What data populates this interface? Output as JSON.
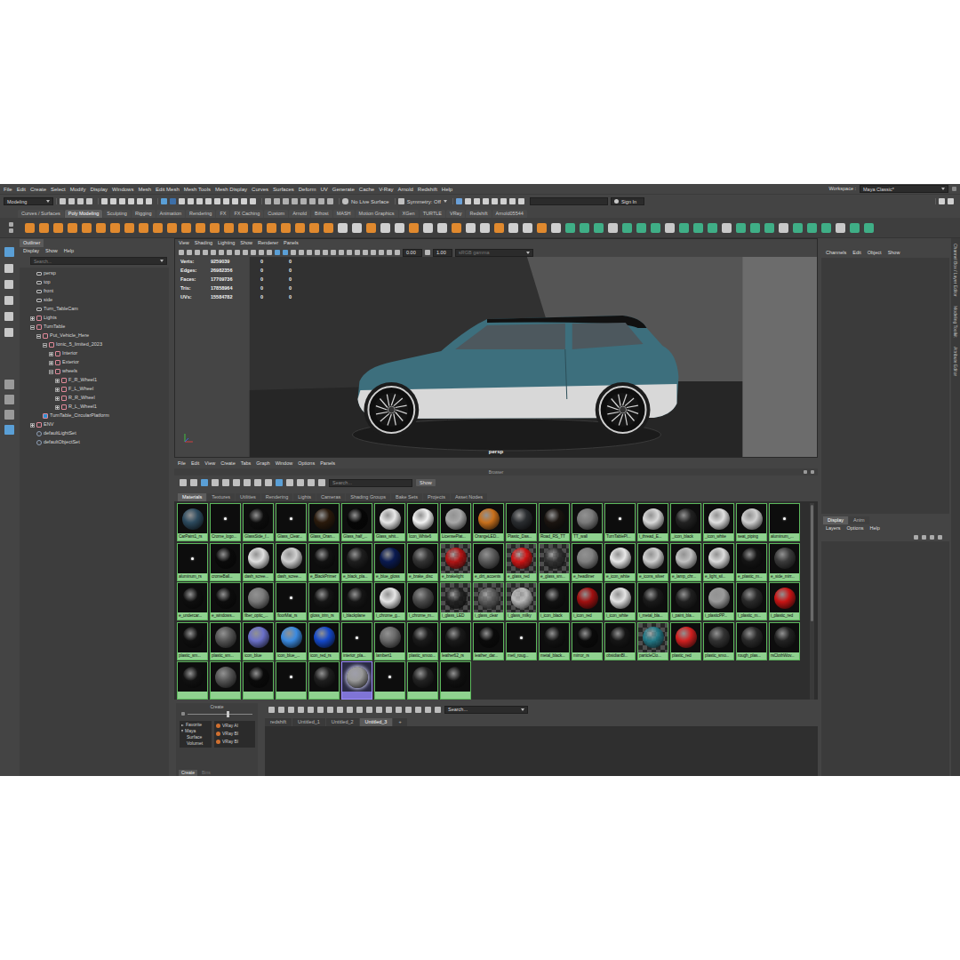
{
  "window": {
    "workspace_label": "Workspace :",
    "workspace": "Maya Classic*"
  },
  "menu_bar": [
    "File",
    "Edit",
    "Create",
    "Select",
    "Modify",
    "Display",
    "Windows",
    "Mesh",
    "Edit Mesh",
    "Mesh Tools",
    "Mesh Display",
    "Curves",
    "Surfaces",
    "Deform",
    "UV",
    "Generate",
    "Cache",
    "V-Ray",
    "Arnold",
    "Redshift",
    "Help"
  ],
  "status_line": {
    "mode": "Modeling",
    "live_surface": "No Live Surface",
    "symmetry": "Symmetry: Off",
    "sign_in": "Sign In"
  },
  "shelf_tabs": [
    {
      "label": "Curves / Surfaces",
      "selected": false
    },
    {
      "label": "Poly Modeling",
      "selected": true
    },
    {
      "label": "Sculpting",
      "selected": false
    },
    {
      "label": "Rigging",
      "selected": false
    },
    {
      "label": "Animation",
      "selected": false
    },
    {
      "label": "Rendering",
      "selected": false
    },
    {
      "label": "FX",
      "selected": false
    },
    {
      "label": "FX Caching",
      "selected": false
    },
    {
      "label": "Custom",
      "selected": false
    },
    {
      "label": "Arnold",
      "selected": false
    },
    {
      "label": "Bifrost",
      "selected": false
    },
    {
      "label": "MASH",
      "selected": false
    },
    {
      "label": "Motion Graphics",
      "selected": false
    },
    {
      "label": "XGen",
      "selected": false
    },
    {
      "label": "TURTLE",
      "selected": false
    },
    {
      "label": "VRay",
      "selected": false
    },
    {
      "label": "Redshift",
      "selected": false
    },
    {
      "label": "Arnold05544",
      "selected": false
    }
  ],
  "outliner": {
    "title": "Outliner",
    "menu": [
      "Display",
      "Show",
      "Help"
    ],
    "search": {
      "placeholder": "Search..."
    },
    "items": [
      {
        "label": "persp",
        "kind": "camera"
      },
      {
        "label": "top",
        "kind": "camera"
      },
      {
        "label": "front",
        "kind": "camera"
      },
      {
        "label": "side",
        "kind": "camera"
      },
      {
        "label": "Turn_TableCam",
        "kind": "camera"
      },
      {
        "label": "Lights",
        "kind": "group",
        "expanded": false
      },
      {
        "label": "TurnTable",
        "kind": "group",
        "expanded": true,
        "children": [
          {
            "label": "Put_Vehicle_Here",
            "kind": "group",
            "expanded": true,
            "children": [
              {
                "label": "Ionic_5_limited_2023",
                "kind": "group",
                "expanded": true,
                "children": [
                  {
                    "label": "Interior",
                    "kind": "group",
                    "expanded": false
                  },
                  {
                    "label": "Exterior",
                    "kind": "group",
                    "expanded": false
                  },
                  {
                    "label": "wheels",
                    "kind": "group",
                    "expanded": true,
                    "children": [
                      {
                        "label": "F_R_Wheel1",
                        "kind": "group",
                        "expanded": false
                      },
                      {
                        "label": "F_L_Wheel",
                        "kind": "group",
                        "expanded": false
                      },
                      {
                        "label": "R_R_Wheel",
                        "kind": "group",
                        "expanded": false
                      },
                      {
                        "label": "R_L_Wheel1",
                        "kind": "group",
                        "expanded": false
                      }
                    ]
                  }
                ]
              }
            ]
          },
          {
            "label": "TurnTable_CircularPlatform",
            "kind": "mesh"
          }
        ]
      },
      {
        "label": "ENV",
        "kind": "group",
        "expanded": false
      },
      {
        "label": "defaultLightSet",
        "kind": "set"
      },
      {
        "label": "defaultObjectSet",
        "kind": "set"
      }
    ]
  },
  "viewport": {
    "menu": [
      "View",
      "Shading",
      "Lighting",
      "Show",
      "Renderer",
      "Panels"
    ],
    "exposure": "0.00",
    "gamma": "1.00",
    "color_space": "sRGB gamma",
    "camera": "persp",
    "hud": [
      {
        "label": "Verts:",
        "values": [
          "9259039",
          "0",
          "0"
        ]
      },
      {
        "label": "Edges:",
        "values": [
          "26982356",
          "0",
          "0"
        ]
      },
      {
        "label": "Faces:",
        "values": [
          "17709736",
          "0",
          "0"
        ]
      },
      {
        "label": "Tris:",
        "values": [
          "17858964",
          "0",
          "0"
        ]
      },
      {
        "label": "UVs:",
        "values": [
          "15584782",
          "0",
          "0"
        ]
      }
    ]
  },
  "hypershade": {
    "menu": [
      "File",
      "Edit",
      "View",
      "Create",
      "Tabs",
      "Graph",
      "Window",
      "Options",
      "Panels"
    ],
    "browser_title": "Browser",
    "search": {
      "placeholder": "Search..."
    },
    "show_button": "Show",
    "tabs": [
      {
        "label": "Materials",
        "selected": true
      },
      {
        "label": "Textures",
        "selected": false
      },
      {
        "label": "Utilities",
        "selected": false
      },
      {
        "label": "Rendering",
        "selected": false
      },
      {
        "label": "Lights",
        "selected": false
      },
      {
        "label": "Cameras",
        "selected": false
      },
      {
        "label": "Shading Groups",
        "selected": false
      },
      {
        "label": "Bake Sets",
        "selected": false
      },
      {
        "label": "Projects",
        "selected": false
      },
      {
        "label": "Asset Nodes",
        "selected": false
      }
    ],
    "materials": [
      {
        "label": "CarPaint1_rs",
        "kind": "sphere",
        "color": "#2c4a5e",
        "selected": false
      },
      {
        "label": "Crome_logo...",
        "kind": "dot",
        "color": "#0d0d0d",
        "selected": false
      },
      {
        "label": "GlassSide_f...",
        "kind": "sphere",
        "color": "#0d0d0d",
        "selected": false
      },
      {
        "label": "Glass_Clear...",
        "kind": "dot",
        "color": "#0d0d0d",
        "selected": false
      },
      {
        "label": "Glass_Oran...",
        "kind": "sphere",
        "color": "#2a1a0c",
        "selected": false
      },
      {
        "label": "Glass_half_...",
        "kind": "sphere",
        "color": "#060606",
        "selected": false
      },
      {
        "label": "Glass_whit...",
        "kind": "sphere",
        "color": "#e8e8e8",
        "selected": false
      },
      {
        "label": "Icon_White6",
        "kind": "sphere",
        "color": "#f2f2f2",
        "selected": false
      },
      {
        "label": "LicensePlat...",
        "kind": "sphere",
        "color": "#a8a8a8",
        "selected": false
      },
      {
        "label": "OrangeLED...",
        "kind": "sphere",
        "color": "#c8701c",
        "selected": false
      },
      {
        "label": "Plastic_Das...",
        "kind": "sphere",
        "color": "#2a2d30",
        "selected": false
      },
      {
        "label": "Road_RS_TT",
        "kind": "sphere",
        "color": "#1a1410",
        "selected": false
      },
      {
        "label": "TT_wall",
        "kind": "sphere",
        "color": "#7a7a7a",
        "selected": false
      },
      {
        "label": "TurnTablePl...",
        "kind": "dot",
        "color": "#0d0d0d",
        "selected": false
      },
      {
        "label": "i_thread_E...",
        "kind": "sphere",
        "color": "#d8d8d8",
        "selected": false
      },
      {
        "label": "_icon_black",
        "kind": "sphere",
        "color": "#222222",
        "selected": false
      },
      {
        "label": "_icon_white",
        "kind": "sphere",
        "color": "#e0e0e0",
        "selected": false
      },
      {
        "label": "seat_piping",
        "kind": "sphere",
        "color": "#d0d0d0",
        "selected": false
      },
      {
        "label": "aluminum_...",
        "kind": "dot",
        "color": "#0d0d0d",
        "selected": false
      },
      {
        "label": "aluminum_rs",
        "kind": "dot",
        "color": "#0d0d0d",
        "selected": false
      },
      {
        "label": "cromeBall...",
        "kind": "sphere",
        "color": "#0a0a0a",
        "selected": false
      },
      {
        "label": "dash_scree...",
        "kind": "sphere",
        "color": "#e0e0e0",
        "selected": false
      },
      {
        "label": "dash_scree...",
        "kind": "sphere",
        "color": "#d0d0d0",
        "selected": false
      },
      {
        "label": "e_BlackPrimer",
        "kind": "sphere",
        "color": "#111111",
        "selected": false
      },
      {
        "label": "e_black_pla...",
        "kind": "sphere",
        "color": "#1e1e1e",
        "selected": false
      },
      {
        "label": "e_blue_gloss",
        "kind": "sphere",
        "color": "#0a1a50",
        "selected": false
      },
      {
        "label": "e_brake_disc",
        "kind": "sphere",
        "color": "#333333",
        "selected": false
      },
      {
        "label": "e_brakelight",
        "kind": "checker",
        "color": "#c01010",
        "selected": false
      },
      {
        "label": "e_dirt_accents",
        "kind": "sphere",
        "color": "#5a5a5a",
        "selected": false
      },
      {
        "label": "e_glass_red",
        "kind": "checker",
        "color": "#e01010",
        "selected": false
      },
      {
        "label": "e_glass_sm...",
        "kind": "checker",
        "color": "#303030",
        "selected": false
      },
      {
        "label": "e_headliner",
        "kind": "sphere",
        "color": "#808080",
        "selected": false
      },
      {
        "label": "e_icon_white",
        "kind": "sphere",
        "color": "#e8e8e8",
        "selected": false
      },
      {
        "label": "e_icons_silver",
        "kind": "sphere",
        "color": "#cfcfcf",
        "selected": false
      },
      {
        "label": "e_lamp_chr...",
        "kind": "sphere",
        "color": "#c0c0c0",
        "selected": false
      },
      {
        "label": "e_light_sil...",
        "kind": "sphere",
        "color": "#dcdcdc",
        "selected": false
      },
      {
        "label": "e_plastic_m...",
        "kind": "sphere",
        "color": "#141414",
        "selected": false
      },
      {
        "label": "e_side_mirr...",
        "kind": "sphere",
        "color": "#3a3a3a",
        "selected": false
      },
      {
        "label": "e_undercar...",
        "kind": "sphere",
        "color": "#0e0e0e",
        "selected": false
      },
      {
        "label": "e_windows...",
        "kind": "sphere",
        "color": "#0c0c0c",
        "selected": false
      },
      {
        "label": "fiber_optic_...",
        "kind": "sphere",
        "color": "#7a7a7a",
        "selected": false
      },
      {
        "label": "floorMat_rs",
        "kind": "dot",
        "color": "#0d0d0d",
        "selected": false
      },
      {
        "label": "gloss_trim_rs",
        "kind": "sphere",
        "color": "#151515",
        "selected": false
      },
      {
        "label": "i_blackplane",
        "kind": "sphere",
        "color": "#151515",
        "selected": false
      },
      {
        "label": "i_chrome_g...",
        "kind": "sphere",
        "color": "#e6e6e6",
        "selected": false
      },
      {
        "label": "i_chrome_m...",
        "kind": "sphere",
        "color": "#4a4a4a",
        "selected": false
      },
      {
        "label": "i_glass_LED",
        "kind": "checker",
        "color": "#202020",
        "selected": false
      },
      {
        "label": "i_glass_clear",
        "kind": "checker",
        "color": "#606060",
        "selected": false
      },
      {
        "label": "i_glass_milky",
        "kind": "checker",
        "color": "#c8c8c8",
        "selected": false
      },
      {
        "label": "i_icon_black",
        "kind": "sphere",
        "color": "#111111",
        "selected": false
      },
      {
        "label": "i_icon_red",
        "kind": "sphere",
        "color": "#a01010",
        "selected": false
      },
      {
        "label": "i_icon_white",
        "kind": "sphere",
        "color": "#e4e4e4",
        "selected": false
      },
      {
        "label": "i_metal_bla...",
        "kind": "sphere",
        "color": "#1a1a1a",
        "selected": false
      },
      {
        "label": "i_paint_bla...",
        "kind": "sphere",
        "color": "#202020",
        "selected": false
      },
      {
        "label": "i_plasticPP...",
        "kind": "sphere",
        "color": "#9a9a9a",
        "selected": false
      },
      {
        "label": "i_plastic_m...",
        "kind": "sphere",
        "color": "#2a2a2a",
        "selected": false
      },
      {
        "label": "i_plastic_red",
        "kind": "sphere",
        "color": "#c81414",
        "selected": false
      },
      {
        "label": "plastic_sm...",
        "kind": "sphere",
        "color": "#0e0e0e",
        "selected": false
      },
      {
        "label": "plastic_sm...",
        "kind": "sphere",
        "color": "#555555",
        "selected": false
      },
      {
        "label": "icon_blue",
        "kind": "sphere",
        "color": "#6a70c8",
        "selected": false
      },
      {
        "label": "icon_blue_...",
        "kind": "sphere",
        "color": "#3a8ae0",
        "selected": false
      },
      {
        "label": "icon_red_rs",
        "kind": "sphere",
        "color": "#1448c8",
        "selected": false
      },
      {
        "label": "interior_pla...",
        "kind": "dot",
        "color": "#0d0d0d",
        "selected": false
      },
      {
        "label": "lambert1",
        "kind": "sphere",
        "color": "#6a6a6a",
        "selected": false
      },
      {
        "label": "plastic_smoo...",
        "kind": "sphere",
        "color": "#1a1a1a",
        "selected": false
      },
      {
        "label": "leather62_rs",
        "kind": "sphere",
        "color": "#1a1a1a",
        "selected": false
      },
      {
        "label": "leather_dar...",
        "kind": "sphere",
        "color": "#0a0a0a",
        "selected": false
      },
      {
        "label": "metl_roug...",
        "kind": "dot",
        "color": "#0d0d0d",
        "selected": false
      },
      {
        "label": "metal_black...",
        "kind": "sphere",
        "color": "#121212",
        "selected": false
      },
      {
        "label": "mirror_rs",
        "kind": "sphere",
        "color": "#0a0a0a",
        "selected": false
      },
      {
        "label": "obsidianBl...",
        "kind": "sphere",
        "color": "#151515",
        "selected": false
      },
      {
        "label": "particleClo...",
        "kind": "checker",
        "color": "#208090",
        "selected": false
      },
      {
        "label": "plastic_red",
        "kind": "sphere",
        "color": "#d02020",
        "selected": false
      },
      {
        "label": "plastic_smo...",
        "kind": "sphere",
        "color": "#333333",
        "selected": false
      },
      {
        "label": "rough_plas...",
        "kind": "sphere",
        "color": "#2a2a2a",
        "selected": false
      },
      {
        "label": "rsClothWov...",
        "kind": "sphere",
        "color": "#222222",
        "selected": false
      },
      {
        "kind": "sphere",
        "color": "#111111",
        "selected": false
      },
      {
        "kind": "sphere",
        "color": "#555555",
        "selected": false
      },
      {
        "kind": "sphere",
        "color": "#0a0a0a",
        "selected": false
      },
      {
        "kind": "dot",
        "color": "#0d0d0d",
        "selected": false
      },
      {
        "kind": "sphere",
        "color": "#1e1e1e",
        "selected": false
      },
      {
        "kind": "sphere",
        "color": "#999999",
        "selected": true
      },
      {
        "kind": "dot",
        "color": "#0d0d0d",
        "selected": false
      },
      {
        "kind": "sphere",
        "color": "#222222",
        "selected": false
      },
      {
        "kind": "sphere",
        "color": "#111111",
        "selected": false
      }
    ],
    "create_panel": {
      "title": "Create",
      "categories": [
        {
          "label": "Favorite",
          "expanded": false
        },
        {
          "label": "Maya",
          "expanded": true,
          "children": [
            "Surface",
            "Volumet"
          ]
        }
      ],
      "nodes": [
        "VRay Al",
        "VRay Bl",
        "VRay Bl"
      ],
      "tabs": [
        {
          "label": "Create",
          "selected": true
        },
        {
          "label": "Bins",
          "selected": false
        }
      ]
    },
    "work_search": {
      "placeholder": "Search..."
    },
    "work_tabs": [
      {
        "label": "redshift",
        "selected": false
      },
      {
        "label": "Untitled_1",
        "selected": false
      },
      {
        "label": "Untitled_2",
        "selected": false
      },
      {
        "label": "Untitled_3",
        "selected": true
      },
      {
        "label": "+",
        "selected": false
      }
    ]
  },
  "channel_box": {
    "menu": [
      "Channels",
      "Edit",
      "Object",
      "Show"
    ]
  },
  "layer_editor": {
    "tabs": [
      {
        "label": "Display",
        "selected": true
      },
      {
        "label": "Anim",
        "selected": false
      }
    ],
    "menu": [
      "Layers",
      "Options",
      "Help"
    ]
  },
  "side_tabs": [
    "Channel Box / Layer Editor",
    "Modeling Toolkit",
    "Attribute Editor"
  ]
}
